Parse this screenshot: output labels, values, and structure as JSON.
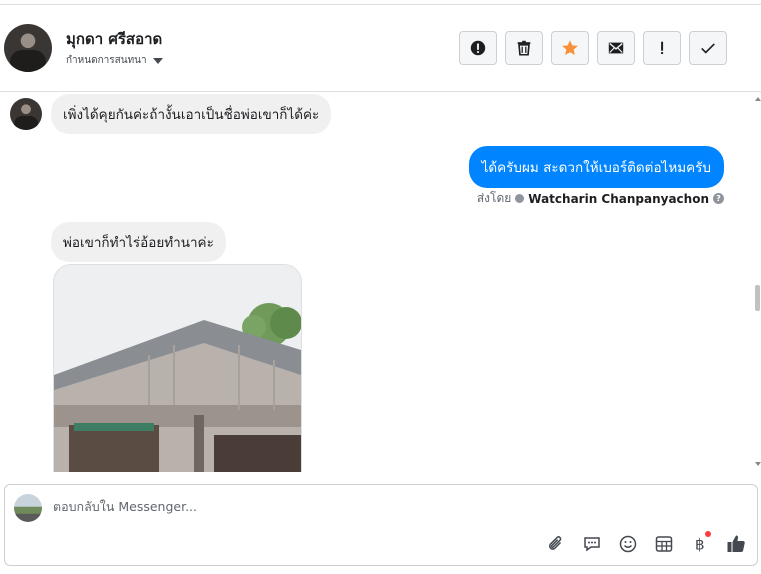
{
  "header": {
    "contact_name": "มุกดา ศรีสอาด",
    "manage_label": "กำหนดการสนทนา",
    "actions": [
      {
        "name": "block-icon"
      },
      {
        "name": "trash-icon"
      },
      {
        "name": "star-icon",
        "color": "#f7923b"
      },
      {
        "name": "mail-icon"
      },
      {
        "name": "exclamation-icon"
      },
      {
        "name": "check-icon"
      }
    ]
  },
  "messages": {
    "m1": "เพิ่งได้คุยกันค่ะถ้างั้นเอาเป็นชื่อพ่อเขาก็ได้ค่ะ",
    "m2": "ได้ครับผม สะดวกให้เบอร์ติดต่อไหมครับ",
    "m2_sent_prefix": "ส่งโดย",
    "m2_sender": "Watcharin Chanpanyachon",
    "m3": "พ่อเขาก็ทำไร่อ้อยทำนาค่ะ"
  },
  "composer": {
    "placeholder": "ตอบกลับใน Messenger...",
    "tools": [
      "attachment-icon",
      "saved-reply-icon",
      "emoji-icon",
      "table-icon",
      "baht-icon",
      "like-icon"
    ]
  },
  "colors": {
    "accent": "#0084ff",
    "star": "#f7923b",
    "notify": "#fa3e3e"
  }
}
